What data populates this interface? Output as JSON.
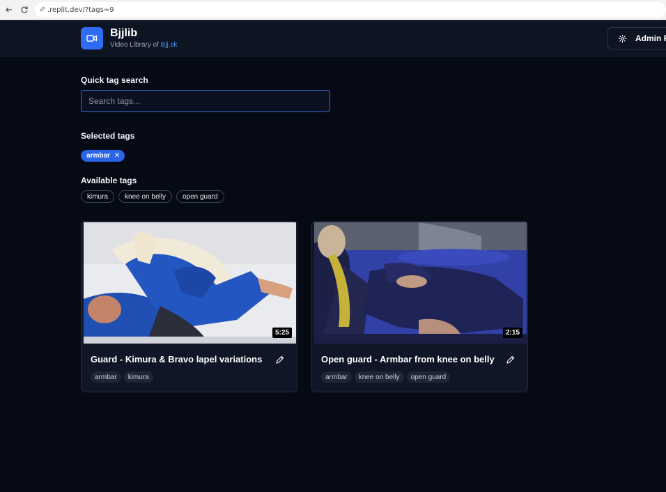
{
  "browser": {
    "url": ".replit.dev/?tags=9"
  },
  "header": {
    "title": "Bjjlib",
    "subtitle_prefix": "Video Library of ",
    "subtitle_link": "Bjj.sk",
    "admin_label": "Admin P"
  },
  "search": {
    "label": "Quick tag search",
    "placeholder": "Search tags...",
    "value": ""
  },
  "selected": {
    "label": "Selected tags",
    "tags": [
      "armbar"
    ]
  },
  "available": {
    "label": "Available tags",
    "tags": [
      "kimura",
      "knee on belly",
      "open guard"
    ]
  },
  "videos": [
    {
      "title": "Guard - Kimura & Bravo lapel variations",
      "duration": "5:25",
      "tags": [
        "armbar",
        "kimura"
      ]
    },
    {
      "title": "Open guard - Armbar from knee on belly",
      "duration": "2:15",
      "tags": [
        "armbar",
        "knee on belly",
        "open guard"
      ]
    }
  ],
  "colors": {
    "accent": "#2f6cf6",
    "background": "#050a14",
    "header_bg": "#0d1422",
    "card_bg": "#0f1626"
  },
  "icons": {
    "logo": "video-camera-icon",
    "admin": "gear-icon",
    "edit": "pencil-icon",
    "remove_tag": "close-icon"
  }
}
